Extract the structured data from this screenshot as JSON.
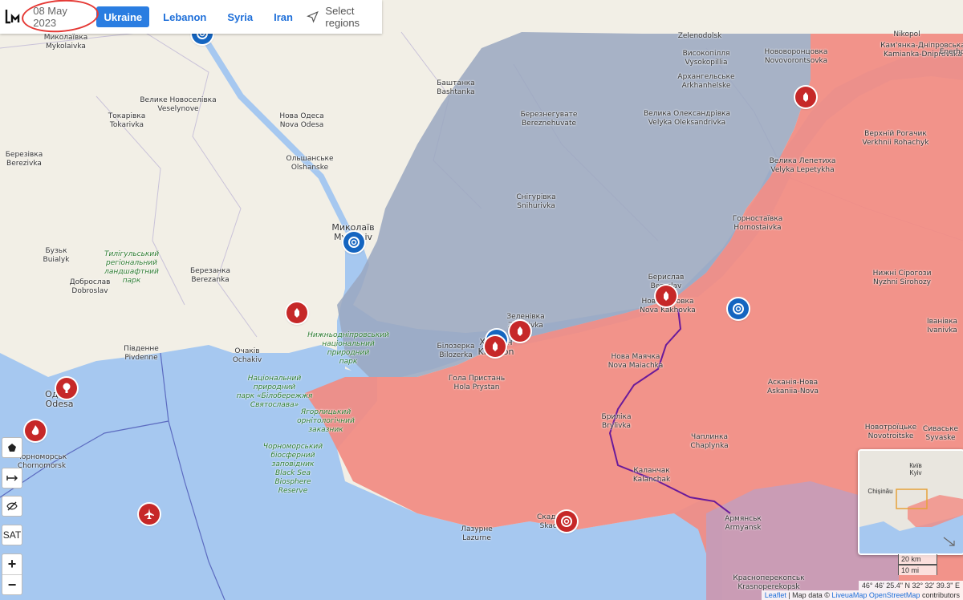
{
  "header": {
    "date": "08 May 2023",
    "tabs": [
      {
        "label": "Ukraine",
        "active": true
      },
      {
        "label": "Lebanon",
        "active": false
      },
      {
        "label": "Syria",
        "active": false
      },
      {
        "label": "Iran",
        "active": false
      }
    ],
    "select_regions": "Select regions"
  },
  "colors": {
    "land": "#f2efe6",
    "sea": "#a6c8f0",
    "occupied": "#f28b82",
    "contested": "#9aa7c0",
    "blue_marker": "#1565c0",
    "red_marker": "#c62828",
    "frontline": "#6a1b9a"
  },
  "places": [
    {
      "ua": "Миколаївка",
      "en": "Mykolaivka"
    },
    {
      "ua": "Велике Новоселівка",
      "en": "Veselynove"
    },
    {
      "ua": "Токарівка",
      "en": "Tokarivka"
    },
    {
      "ua": "Березівка",
      "en": "Berezivka"
    },
    {
      "ua": "Нова Одеса",
      "en": "Nova Odesa"
    },
    {
      "ua": "Ольшанське",
      "en": "Olshanske"
    },
    {
      "ua": "Баштанка",
      "en": "Bashtanka"
    },
    {
      "ua": "Березнегувате",
      "en": "Bereznehuvate"
    },
    {
      "ua": "Снігурівка",
      "en": "Snihurivka"
    },
    {
      "ua": "Миколаїв",
      "en": "Mykolaiv"
    },
    {
      "ua": "Бузьк",
      "en": "Buialyk"
    },
    {
      "ua": "Доброслав",
      "en": "Dobroslav"
    },
    {
      "ua": "Березанка",
      "en": "Berezanka"
    },
    {
      "ua": "Очаків",
      "en": "Ochakiv"
    },
    {
      "ua": "Південне",
      "en": "Pivdenne"
    },
    {
      "ua": "Одеса",
      "en": "Odesa"
    },
    {
      "ua": "Чорноморськ",
      "en": "Chornomorsk"
    },
    {
      "ua": "Зеленівка",
      "en": "Zelenivka"
    },
    {
      "ua": "Білозерка",
      "en": "Bilozerka"
    },
    {
      "ua": "Херсон",
      "en": "Kherson"
    },
    {
      "ua": "Гола Пристань",
      "en": "Hola Prystan"
    },
    {
      "ua": "Берислав",
      "en": "Beryslav"
    },
    {
      "ua": "Нова Каховка",
      "en": "Nova Kakhovka"
    },
    {
      "ua": "Нова Маячка",
      "en": "Nova Maiachka"
    },
    {
      "ua": "Бриліка",
      "en": "Brylivka"
    },
    {
      "ua": "Каланчак",
      "en": "Kalanchak"
    },
    {
      "ua": "Лазурне",
      "en": "Lazurne"
    },
    {
      "ua": "Скадовськ",
      "en": "Skadovsk"
    },
    {
      "ua": "Високопілля",
      "en": "Vysokopillia"
    },
    {
      "ua": "Архангельське",
      "en": "Arkhanhelske"
    },
    {
      "ua": "Велика Олександрівка",
      "en": "Velyka Oleksandrivka"
    },
    {
      "ua": "Нововоронцовка",
      "en": "Novovorontsovka"
    },
    {
      "ua": "Велика Лепетиха",
      "en": "Velyka Lepetykha"
    },
    {
      "ua": "Горностаївка",
      "en": "Hornostaivka"
    },
    {
      "ua": "Кам'янка-Дніпровська",
      "en": "Kamianka-Dniprovska"
    },
    {
      "ua": "Верхній Рогачик",
      "en": "Verkhnii Rohachyk"
    },
    {
      "ua": "Нижні Сірогози",
      "en": "Nyzhni Sirohozy"
    },
    {
      "ua": "Іванівка",
      "en": "Ivanivka"
    },
    {
      "ua": "Асканія-Нова",
      "en": "Askaniia-Nova"
    },
    {
      "ua": "Чаплинка",
      "en": "Chaplynka"
    },
    {
      "ua": "Новотроїцьке",
      "en": "Novotroitske"
    },
    {
      "ua": "Сиваське",
      "en": "Syvaske"
    },
    {
      "ua": "Армянськ",
      "en": "Armyansk"
    },
    {
      "ua": "Красноперекопськ",
      "en": "Krasnoperekopsk"
    }
  ],
  "parks": [
    {
      "lines": [
        "Тилігульський",
        "регіональний",
        "ландшафтний",
        "парк"
      ]
    },
    {
      "lines": [
        "Нижньодніпровський",
        "національний",
        "природний",
        "парк"
      ]
    },
    {
      "lines": [
        "Національний",
        "природний",
        "парк «Білобережжя",
        "Святослава»"
      ]
    },
    {
      "lines": [
        "Ягорлицький",
        "орнітологічний",
        "заказник"
      ]
    },
    {
      "lines": [
        "Чорноморський",
        "біосферний",
        "заповідник",
        "Black Sea",
        "Biosphere",
        "Reserve"
      ]
    }
  ],
  "misc_text": {
    "zelenodolsk": "Zelenodolsk",
    "nikopol": "Nikopol",
    "enerhodar": "Enerhodar"
  },
  "controls": {
    "sat": "SAT",
    "zoom_in": "+",
    "zoom_out": "−"
  },
  "minimap": {
    "kyiv_ua": "Київ",
    "kyiv_en": "Kyiv",
    "chisinau": "Chișinău"
  },
  "scale": {
    "km": "20 km",
    "mi": "10 mi"
  },
  "coordinates": "46° 46' 25.4\" N 32° 32' 39.3\" E",
  "attribution": {
    "leaflet": "Leaflet",
    "text": "| Map data ©",
    "liveuamap": "LiveuaMap",
    "osm": "OpenStreetMap",
    "contributors": "contributors"
  }
}
